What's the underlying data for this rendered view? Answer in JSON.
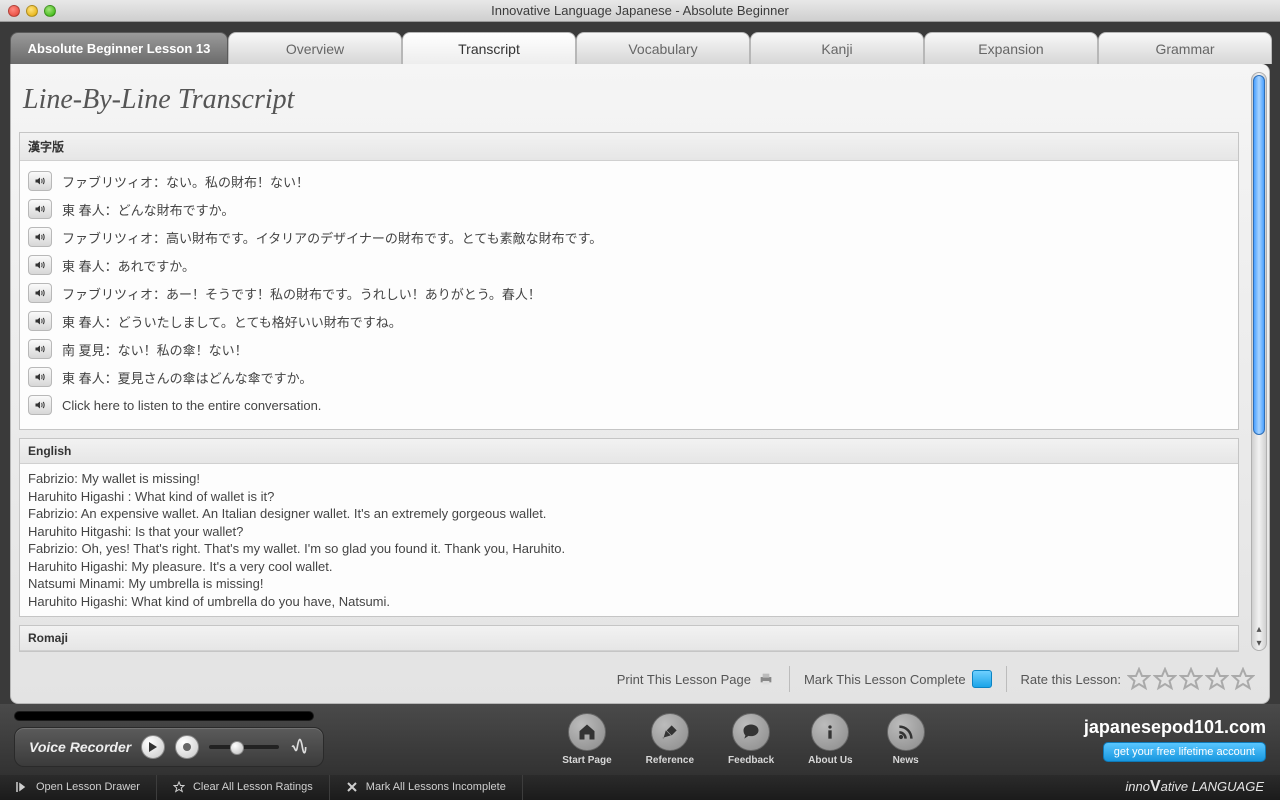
{
  "window": {
    "title": "Innovative Language Japanese - Absolute Beginner"
  },
  "tabs": {
    "lesson_label": "Absolute Beginner Lesson 13",
    "items": [
      "Overview",
      "Transcript",
      "Vocabulary",
      "Kanji",
      "Expansion",
      "Grammar"
    ],
    "active_index": 1
  },
  "heading": "Line-By-Line Transcript",
  "sections": {
    "kanji": {
      "title": "漢字版",
      "lines": [
        "ファブリツィオ：ない。私の財布！ない！",
        "東 春人：どんな財布ですか。",
        "ファブリツィオ：高い財布です。イタリアのデザイナーの財布です。とても素敵な財布です。",
        "東 春人：あれですか。",
        "ファブリツィオ：あー！そうです！私の財布です。うれしい！ありがとう。春人！",
        "東 春人：どういたしまして。とても格好いい財布ですね。",
        "南 夏見：ない！私の傘！ない！",
        "東 春人：夏見さんの傘はどんな傘ですか。",
        "Click here to listen to the entire conversation."
      ]
    },
    "english": {
      "title": "English",
      "lines": [
        "Fabrizio: My wallet is missing!",
        "Haruhito Higashi : What kind of wallet is it?",
        "Fabrizio: An expensive wallet. An Italian designer wallet. It's an extremely gorgeous wallet.",
        "Haruhito Hitgashi: Is that your wallet?",
        "Fabrizio: Oh, yes! That's right. That's my wallet. I'm so glad you found it. Thank you, Haruhito.",
        "Haruhito Higashi: My pleasure. It's a very cool wallet.",
        "Natsumi Minami: My umbrella is missing!",
        "Haruhito Higashi: What kind of umbrella do you have, Natsumi."
      ]
    },
    "romaji": {
      "title": "Romaji"
    }
  },
  "actions": {
    "print": "Print This Lesson Page",
    "complete": "Mark This Lesson Complete",
    "rate": "Rate this Lesson:"
  },
  "voice_recorder": {
    "label": "Voice Recorder"
  },
  "nav": {
    "items": [
      {
        "id": "start",
        "label": "Start Page"
      },
      {
        "id": "reference",
        "label": "Reference"
      },
      {
        "id": "feedback",
        "label": "Feedback"
      },
      {
        "id": "about",
        "label": "About Us"
      },
      {
        "id": "news",
        "label": "News"
      }
    ]
  },
  "brand": {
    "site": "japanesepod101.com",
    "cta": "get your free lifetime account",
    "footer_pre": "inno",
    "footer_v": "V",
    "footer_post": "ative LANGUAGE"
  },
  "statusbar": {
    "open_drawer": "Open Lesson Drawer",
    "clear_ratings": "Clear All Lesson Ratings",
    "mark_incomplete": "Mark All Lessons Incomplete"
  }
}
